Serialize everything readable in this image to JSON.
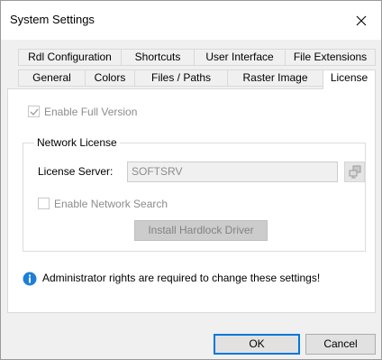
{
  "window": {
    "title": "System Settings"
  },
  "tabs": {
    "row1": [
      {
        "label": "Rdl Configuration"
      },
      {
        "label": "Shortcuts"
      },
      {
        "label": "User Interface"
      },
      {
        "label": "File Extensions"
      }
    ],
    "row2": [
      {
        "label": "General"
      },
      {
        "label": "Colors"
      },
      {
        "label": "Files / Paths"
      },
      {
        "label": "Raster Image"
      },
      {
        "label": "License",
        "active": true
      }
    ]
  },
  "license": {
    "enable_full_version": {
      "label": "Enable Full Version",
      "checked": true,
      "enabled": false
    },
    "network_group": {
      "title": "Network License",
      "server_label": "License Server:",
      "server_value": "SOFTSRV",
      "browse_icon": "network-computer-icon",
      "enable_network_search": {
        "label": "Enable Network Search",
        "checked": false,
        "enabled": false
      },
      "install_driver_label": "Install Hardlock Driver"
    },
    "info_icon": "info-icon",
    "info_message": "Administrator rights are required to change these settings!"
  },
  "buttons": {
    "ok": "OK",
    "cancel": "Cancel"
  },
  "colors": {
    "accent": "#0078d7",
    "info_blue": "#1e7fd6"
  }
}
